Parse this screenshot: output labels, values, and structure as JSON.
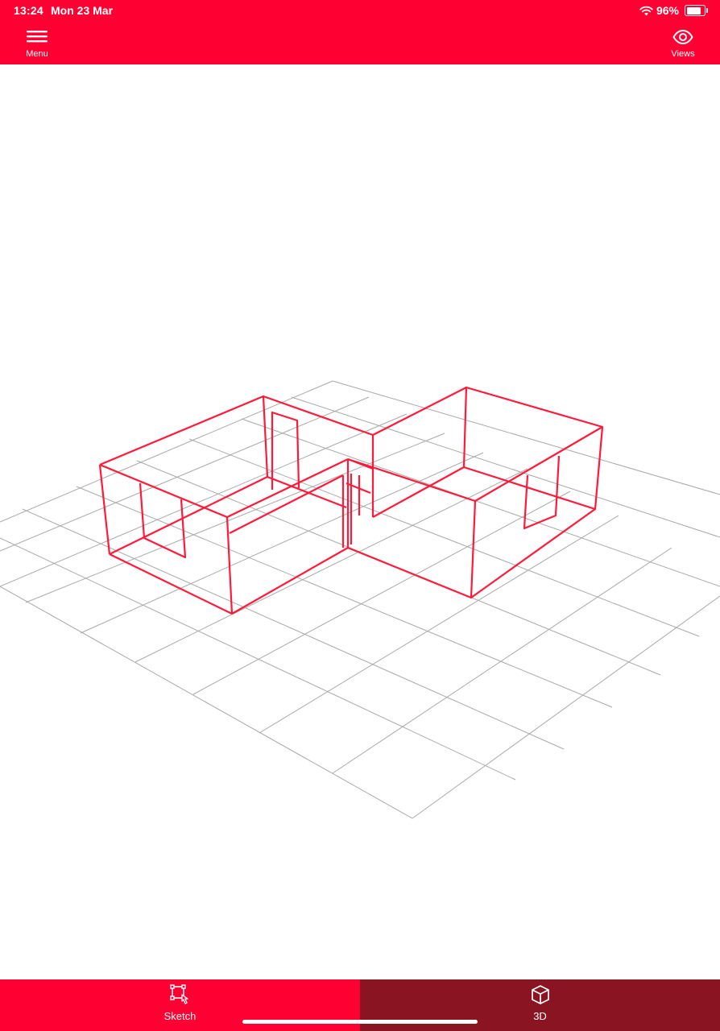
{
  "status_bar": {
    "time": "13:24",
    "date": "Mon 23 Mar",
    "battery_text": "96%",
    "battery_level": 0.96,
    "wifi_icon": "wifi-icon"
  },
  "header": {
    "menu_label": "Menu",
    "menu_icon": "hamburger-menu-icon",
    "views_label": "Views",
    "views_icon": "eye-icon"
  },
  "tabs": {
    "sketch_label": "Sketch",
    "sketch_icon": "sketch-draw-icon",
    "three_d_label": "3D",
    "three_d_icon": "cube-icon",
    "active": "3D"
  },
  "colors": {
    "brand": "#ff0033",
    "active_tab": "#8a1422",
    "wireframe": "#ff1a3a",
    "grid": "#a9a9a9"
  }
}
